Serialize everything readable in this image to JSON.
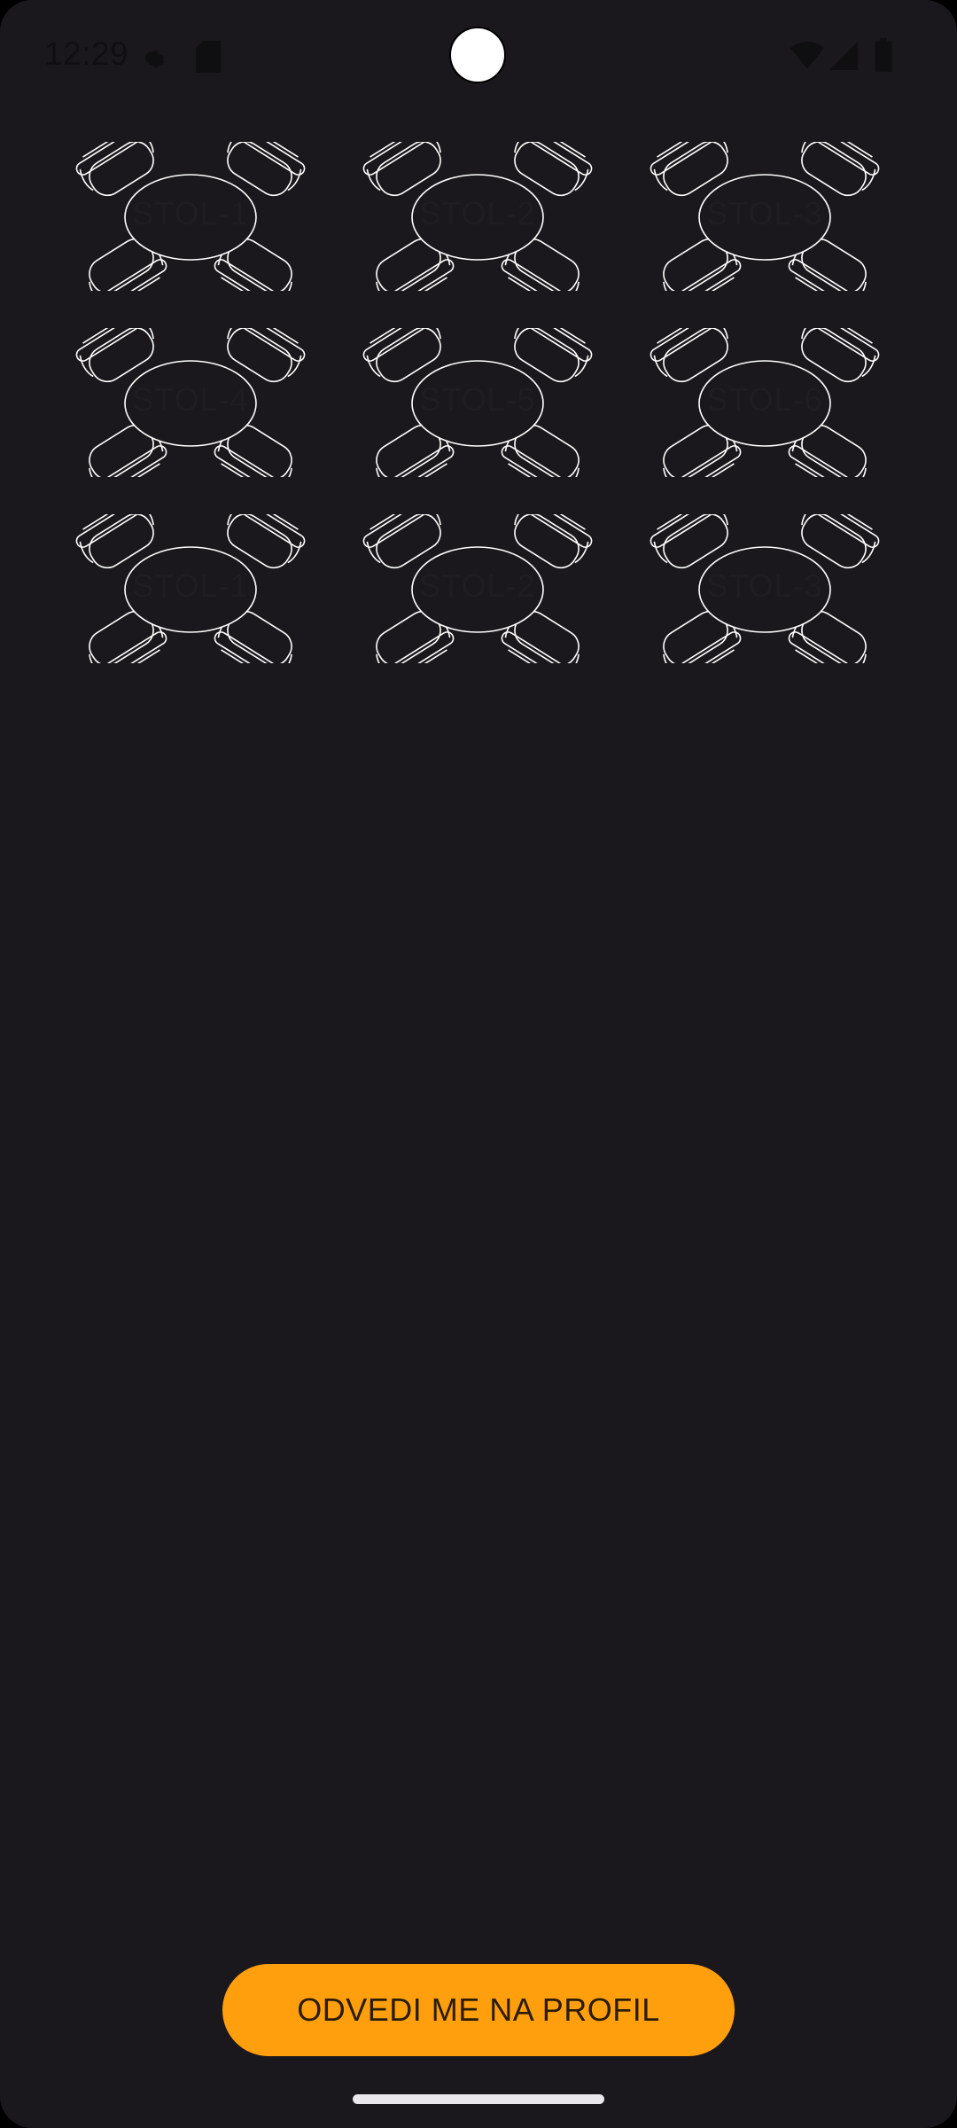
{
  "status_bar": {
    "time": "12:29",
    "left_icons": [
      "settings-gear-icon",
      "sd-card-icon"
    ],
    "right_icons": [
      "wifi-icon",
      "signal-icon",
      "battery-icon"
    ]
  },
  "tables": [
    {
      "label": "STOL-1"
    },
    {
      "label": "STOL-2"
    },
    {
      "label": "STOL-3"
    },
    {
      "label": "STOL-4"
    },
    {
      "label": "STOL-5"
    },
    {
      "label": "STOL-6"
    },
    {
      "label": "STOL-1"
    },
    {
      "label": "STOL-2"
    },
    {
      "label": "STOL-3"
    }
  ],
  "profile_button": {
    "label": "ODVEDI ME NA PROFIL"
  },
  "colors": {
    "background": "#1a181c",
    "accent": "#ff9f0d",
    "outline": "#ffffff"
  }
}
